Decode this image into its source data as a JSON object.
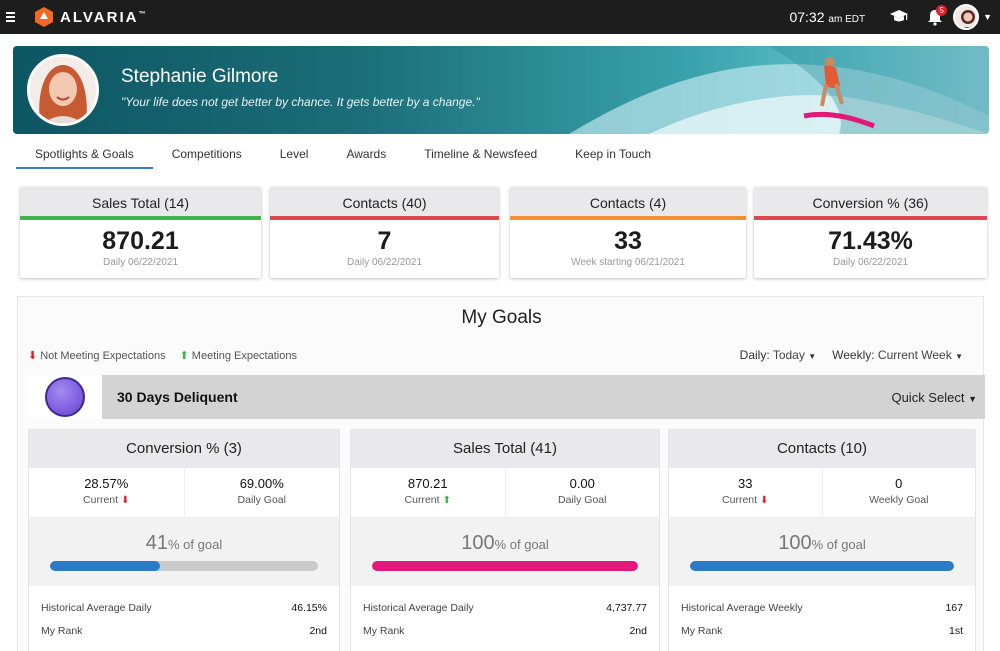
{
  "topbar": {
    "brand": "ALVARIA",
    "trademark": "™",
    "time": "07:32",
    "time_suffix": "am EDT",
    "notification_count": "5"
  },
  "banner": {
    "name": "Stephanie Gilmore",
    "quote": "\"Your life does not get better by chance. It gets better by a change.\""
  },
  "tabs": [
    {
      "label": "Spotlights & Goals",
      "active": true
    },
    {
      "label": "Competitions"
    },
    {
      "label": "Level"
    },
    {
      "label": "Awards"
    },
    {
      "label": "Timeline & Newsfeed"
    },
    {
      "label": "Keep in Touch"
    }
  ],
  "kpis": [
    {
      "title": "Sales Total (14)",
      "value": "870.21",
      "sub": "Daily 06/22/2021",
      "color": "#3db54a"
    },
    {
      "title": "Contacts (40)",
      "value": "7",
      "sub": "Daily 06/22/2021",
      "color": "#e0464d"
    },
    {
      "title": "Contacts (4)",
      "value": "33",
      "sub": "Week starting 06/21/2021",
      "color": "#f0922f"
    },
    {
      "title": "Conversion % (36)",
      "value": "71.43%",
      "sub": "Daily 06/22/2021",
      "color": "#e0464d"
    }
  ],
  "goals": {
    "title": "My Goals",
    "legend_not_meeting": "Not Meeting Expectations",
    "legend_meeting": "Meeting Expectations",
    "daily_label": "Daily:",
    "daily_value": "Today",
    "weekly_label": "Weekly:",
    "weekly_value": "Current Week",
    "group_label": "30 Days Deliquent",
    "quick_select": "Quick Select",
    "cards": [
      {
        "title": "Conversion % (3)",
        "current": "28.57%",
        "current_label": "Current",
        "current_trend": "down",
        "goal": "69.00%",
        "goal_label": "Daily Goal",
        "pct": "41",
        "pct_unit": "% of goal",
        "progress": 0.41,
        "bar_color": "#2b7bc7",
        "hist_label": "Historical Average Daily",
        "hist_value": "46.15%",
        "rank_label": "My Rank",
        "rank_value": "2nd"
      },
      {
        "title": "Sales Total (41)",
        "current": "870.21",
        "current_label": "Current",
        "current_trend": "up",
        "goal": "0.00",
        "goal_label": "Daily Goal",
        "pct": "100",
        "pct_unit": "% of goal",
        "progress": 1.0,
        "bar_color": "#e0197a",
        "hist_label": "Historical Average Daily",
        "hist_value": "4,737.77",
        "rank_label": "My Rank",
        "rank_value": "2nd"
      },
      {
        "title": "Contacts (10)",
        "current": "33",
        "current_label": "Current",
        "current_trend": "down",
        "goal": "0",
        "goal_label": "Weekly Goal",
        "pct": "100",
        "pct_unit": "% of goal",
        "progress": 1.0,
        "bar_color": "#2b7bc7",
        "hist_label": "Historical Average Weekly",
        "hist_value": "167",
        "rank_label": "My Rank",
        "rank_value": "1st"
      }
    ]
  },
  "colors": {
    "down_arrow": "#e02020",
    "up_arrow": "#3db54a",
    "tab_active": "#3a7cc5"
  },
  "icons": [
    "menu-icon",
    "alvaria-logo-icon",
    "graduation-cap-icon",
    "bell-icon",
    "user-avatar",
    "chevron-down-icon",
    "down-arrow-icon",
    "up-arrow-icon",
    "group-circle-icon"
  ]
}
